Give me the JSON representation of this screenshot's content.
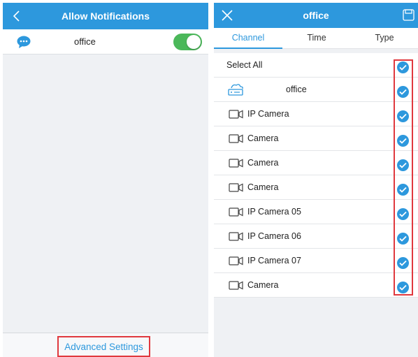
{
  "left": {
    "header": {
      "title": "Allow Notifications",
      "back_icon": "chevron-left-icon"
    },
    "device": {
      "name": "office",
      "icon": "chat-bubble-icon",
      "notifications_enabled": true
    },
    "footer": {
      "advanced_settings_label": "Advanced Settings"
    }
  },
  "right": {
    "header": {
      "title": "office",
      "close_icon": "close-icon",
      "save_icon": "save-icon"
    },
    "tabs": [
      {
        "label": "Channel",
        "active": true
      },
      {
        "label": "Time",
        "active": false
      },
      {
        "label": "Type",
        "active": false
      }
    ],
    "select_all": {
      "label": "Select All",
      "checked": true
    },
    "channels": [
      {
        "label": "office",
        "icon": "nvr-device-icon",
        "checked": true
      },
      {
        "label": "IP Camera",
        "icon": "camera-icon",
        "checked": true
      },
      {
        "label": "Camera",
        "icon": "camera-icon",
        "checked": true
      },
      {
        "label": "Camera",
        "icon": "camera-icon",
        "checked": true
      },
      {
        "label": "Camera",
        "icon": "camera-icon",
        "checked": true
      },
      {
        "label": "IP Camera 05",
        "icon": "camera-icon",
        "checked": true
      },
      {
        "label": "IP Camera 06",
        "icon": "camera-icon",
        "checked": true
      },
      {
        "label": "IP Camera 07",
        "icon": "camera-icon",
        "checked": true
      },
      {
        "label": "Camera",
        "icon": "camera-icon",
        "checked": true
      }
    ]
  },
  "colors": {
    "primary": "#2d98dd",
    "toggle_on": "#4bb85a",
    "highlight_border": "#e0393e",
    "background": "#eff1f4"
  }
}
